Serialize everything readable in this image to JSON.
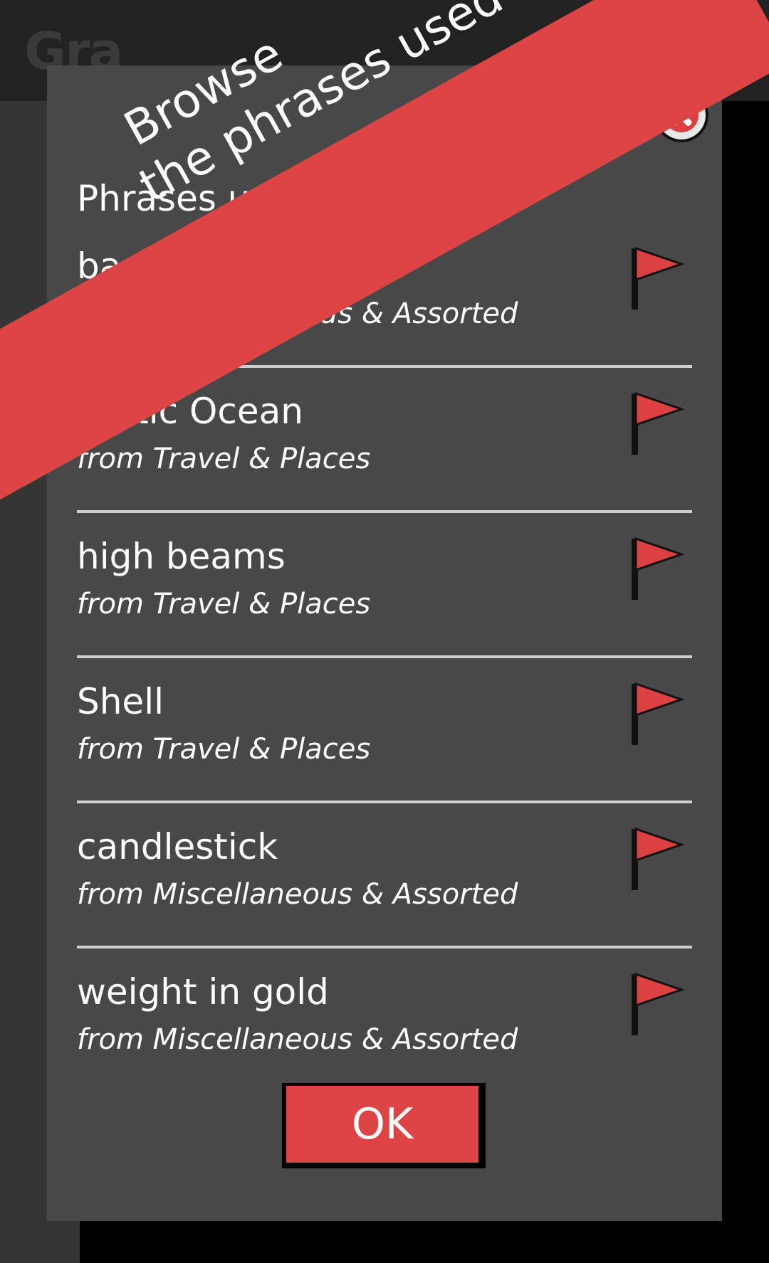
{
  "app": {
    "title": "Gra"
  },
  "dialog": {
    "heading": "Phrases used last round",
    "items": [
      {
        "phrase": "back on track",
        "category": "from Miscellaneous & Assorted"
      },
      {
        "phrase": "Arctic Ocean",
        "category": "from Travel & Places"
      },
      {
        "phrase": "high beams",
        "category": "from Travel & Places"
      },
      {
        "phrase": "Shell",
        "category": "from Travel & Places"
      },
      {
        "phrase": "candlestick",
        "category": "from Miscellaneous & Assorted"
      },
      {
        "phrase": "weight in gold",
        "category": "from Miscellaneous & Assorted"
      }
    ],
    "ok_label": "OK"
  },
  "banner": {
    "line1": "Browse",
    "line2": "the phrases used"
  },
  "icons": {
    "help": "help-icon",
    "menu": "menu-icon",
    "list": "list-icon",
    "close": "close-icon",
    "flag": "flag-icon"
  },
  "colors": {
    "accent": "#dd4545",
    "dialog_bg": "#484848",
    "topbar_bg": "#222222"
  }
}
